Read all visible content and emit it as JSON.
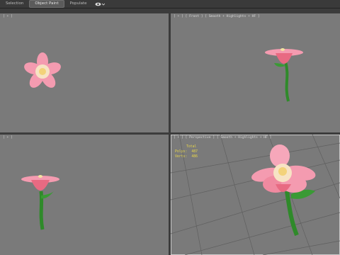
{
  "toolbar": {
    "tabs": [
      {
        "label": "Selection",
        "active": false
      },
      {
        "label": "Object Paint",
        "active": true
      },
      {
        "label": "Populate",
        "active": false
      }
    ],
    "visibility_icon": "eye-icon"
  },
  "viewports": {
    "top": {
      "label": "[ + ]"
    },
    "front": {
      "label": "[ + ] [ Front ] [ Smooth + Highlights + HF ]"
    },
    "left": {
      "label": "[ + ]"
    },
    "perspective": {
      "label": "[ + ] [ Perspective ] [ Smooth + Highlights + HF ]",
      "stats": {
        "title": "Total",
        "polys_label": "Polys:",
        "polys_value": "487",
        "verts_label": "Verts:",
        "verts_value": "486"
      }
    }
  },
  "colors": {
    "viewport_bg": "#7a7a7a",
    "petal": "#f28fa3",
    "stem": "#2f8a2a",
    "stats_text": "#e8d64a"
  }
}
